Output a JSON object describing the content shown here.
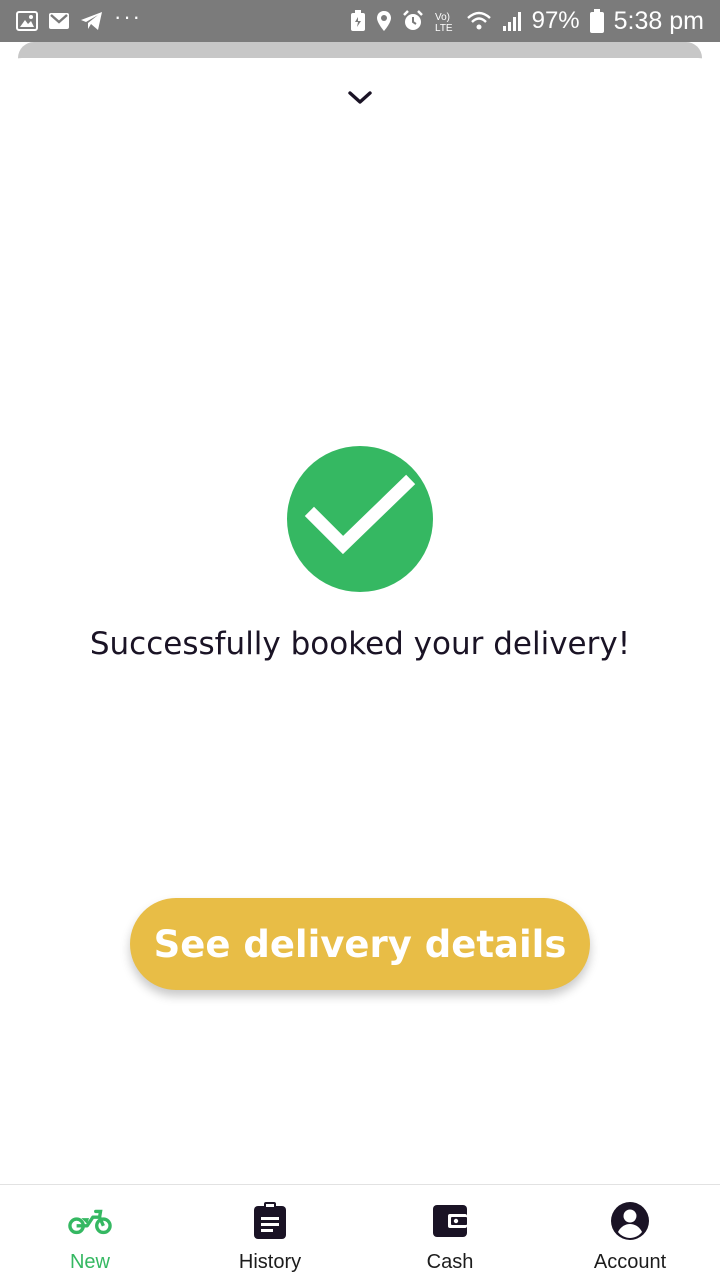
{
  "status_bar": {
    "left_icons": [
      "gallery-icon",
      "gmail-icon",
      "telegram-icon",
      "more-notifications-icon"
    ],
    "more": "···",
    "right_icons": [
      "battery-saver-icon",
      "location-icon",
      "alarm-icon",
      "volte-icon",
      "wifi-icon",
      "signal-icon",
      "battery-icon"
    ],
    "battery": "97%",
    "time": "5:38 pm"
  },
  "sheet": {
    "collapse_icon": "chevron-down-icon",
    "success_icon": "check-circle-icon",
    "message": "Successfully booked your delivery!",
    "button_label": "See delivery details"
  },
  "colors": {
    "success": "#35b862",
    "button": "#e8bd46",
    "status_bar": "#7b7b7b",
    "active_nav": "#35b862"
  },
  "bottom_nav": {
    "active": "New",
    "items": [
      {
        "label": "New",
        "icon": "motorcycle-icon"
      },
      {
        "label": "History",
        "icon": "clipboard-icon"
      },
      {
        "label": "Cash",
        "icon": "wallet-icon"
      },
      {
        "label": "Account",
        "icon": "account-circle-icon"
      }
    ]
  }
}
